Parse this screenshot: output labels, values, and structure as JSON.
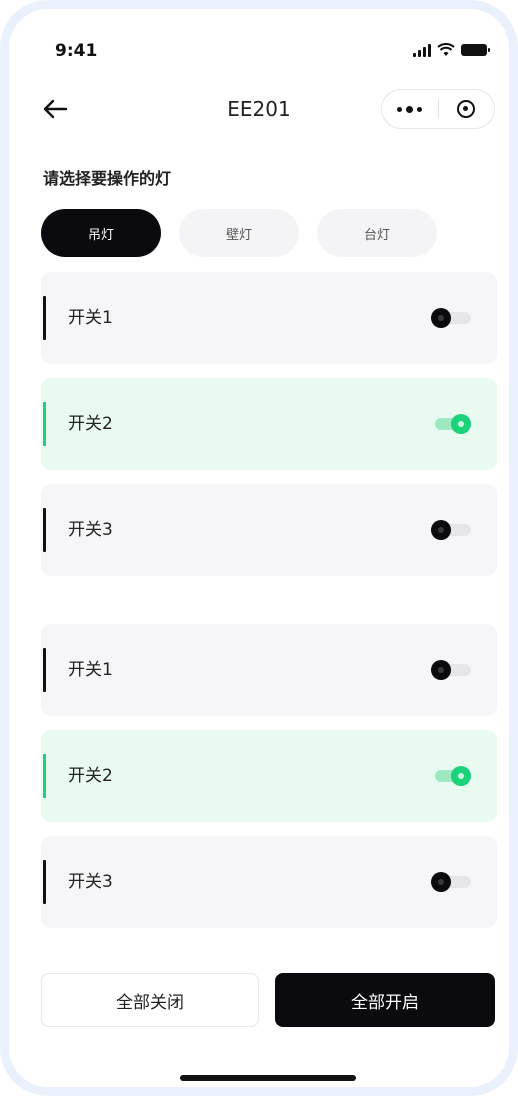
{
  "status_bar": {
    "time": "9:41"
  },
  "nav": {
    "title": "EE201",
    "icons": {
      "back": "arrow-left-icon",
      "more": "more-dots-icon",
      "close": "target-circle-icon"
    }
  },
  "section_title": "请选择要操作的灯",
  "tabs": [
    {
      "label": "吊灯",
      "active": true
    },
    {
      "label": "壁灯",
      "active": false
    },
    {
      "label": "台灯",
      "active": false
    }
  ],
  "groups": [
    {
      "switches": [
        {
          "label": "开关1",
          "on": false
        },
        {
          "label": "开关2",
          "on": true
        },
        {
          "label": "开关3",
          "on": false
        }
      ]
    },
    {
      "switches": [
        {
          "label": "开关1",
          "on": false
        },
        {
          "label": "开关2",
          "on": true
        },
        {
          "label": "开关3",
          "on": false
        }
      ]
    }
  ],
  "actions": {
    "all_off": "全部关闭",
    "all_on": "全部开启"
  },
  "colors": {
    "accent": "#19d27a",
    "dark": "#0a0a0f",
    "on_bg": "#e9fbf1",
    "card_bg": "#f6f6f8"
  }
}
